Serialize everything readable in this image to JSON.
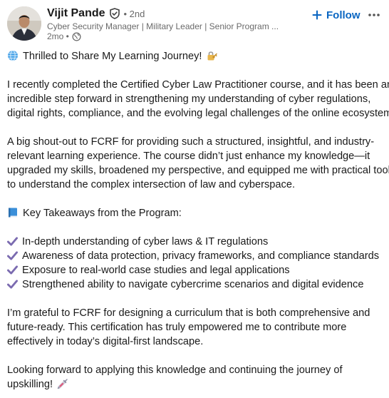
{
  "author": {
    "name": "Vijit Pande",
    "degree": "• 2nd",
    "headline": "Cyber Security Manager | Military Leader | Senior Program ...",
    "time": "2mo •"
  },
  "actions": {
    "follow_label": "Follow"
  },
  "icons": {
    "verified": "verified-shield-icon",
    "visibility": "globe-icon",
    "follow": "plus-icon",
    "more": "ellipsis-icon",
    "intro": "globe-emoji-icon",
    "intro_tail": "locked-with-key-emoji-icon",
    "takeaways": "blue-book-emoji-icon",
    "bullet": "check-mark-icon",
    "closing": "syringe-emoji-icon"
  },
  "colors": {
    "link_blue": "#0a66c2",
    "check_purple": "#7b6bb0",
    "secondary_text": "rgba(0,0,0,0.6)"
  },
  "post": {
    "intro": "Thrilled to Share My Learning Journey!",
    "para1": [
      "I recently completed the Certified Cyber Law Practitioner course, and it has been an",
      "incredible step forward in strengthening my understanding of cyber regulations,",
      "digital rights, compliance, and the evolving legal challenges of the online ecosystem."
    ],
    "para2": [
      "A big shout-out to FCRF for providing such a structured, insightful, and industry-",
      "relevant learning experience. The course didn’t just enhance my knowledge—it",
      "upgraded my skills, broadened my perspective, and equipped me with practical tools",
      "to understand the complex intersection of law and cyberspace."
    ],
    "takeaways_heading": "Key Takeaways from the Program:",
    "takeaways": [
      "In-depth understanding of cyber laws & IT regulations",
      "Awareness of data protection, privacy frameworks, and compliance standards",
      "Exposure to real-world case studies and legal applications",
      "Strengthened ability to navigate cybercrime scenarios and digital evidence"
    ],
    "para3": [
      "I’m grateful to FCRF for designing a curriculum that is both comprehensive and",
      "future-ready. This certification has truly empowered me to contribute more",
      "effectively in today’s digital-first landscape."
    ],
    "para4": [
      "Looking forward to applying this knowledge and continuing the journey of",
      "upskilling!"
    ]
  }
}
